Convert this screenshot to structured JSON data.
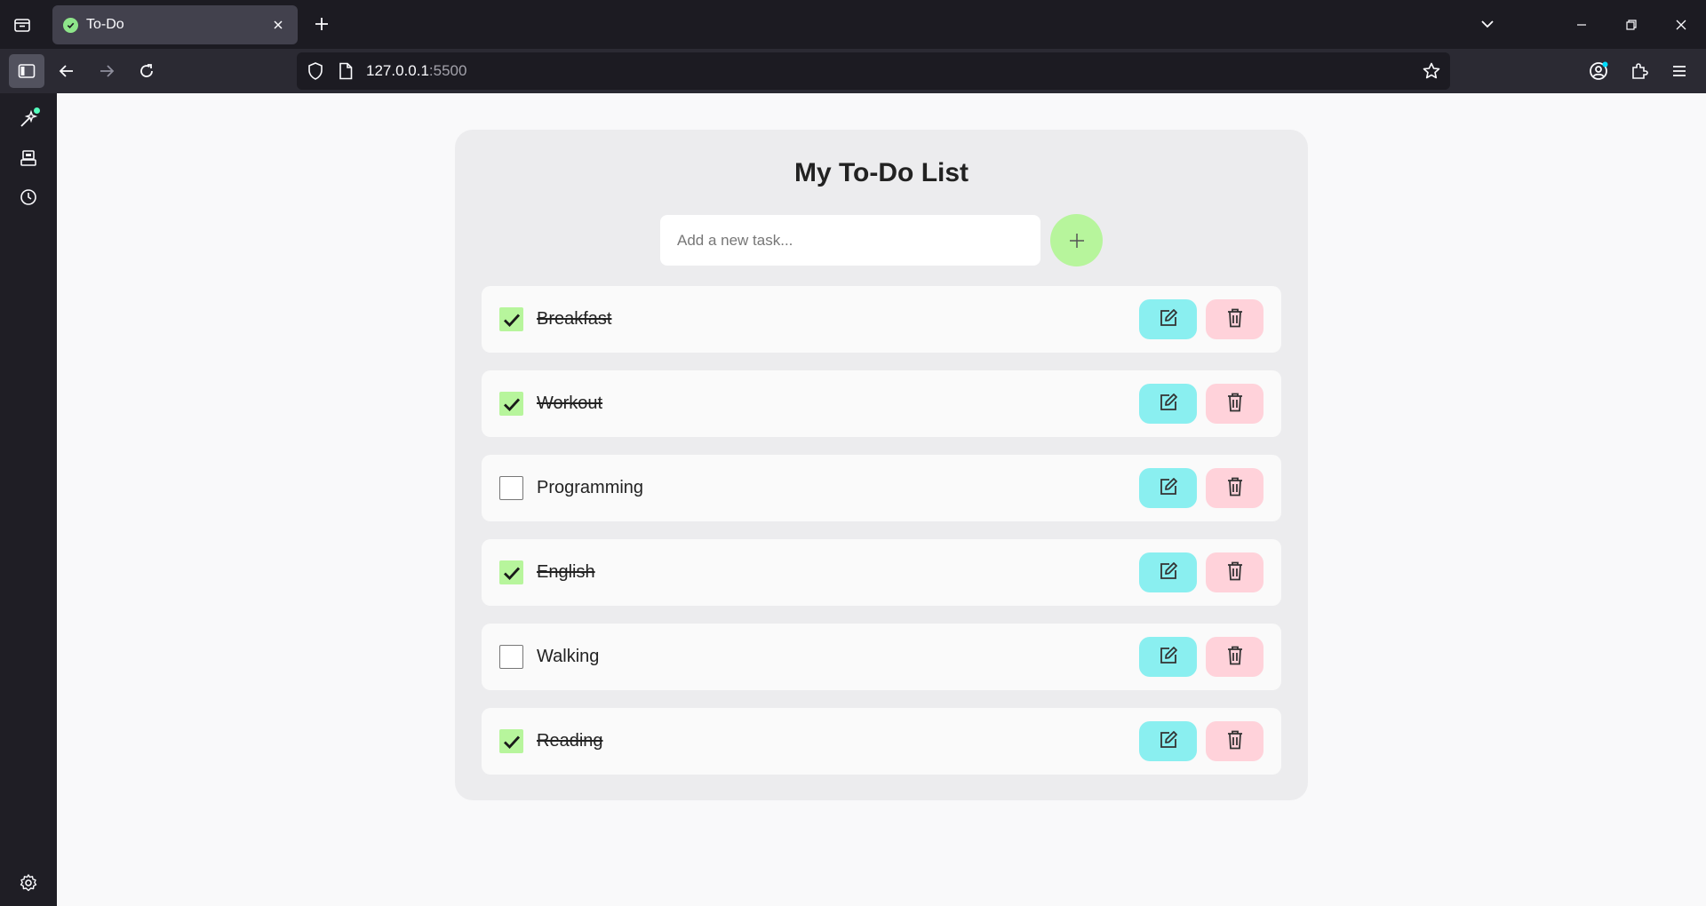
{
  "browser": {
    "tab": {
      "title": "To-Do"
    },
    "url": {
      "host": "127.0.0.1",
      "port": ":5500"
    }
  },
  "app": {
    "title": "My To-Do List",
    "input_placeholder": "Add a new task...",
    "input_value": "",
    "tasks": [
      {
        "label": "Breakfast",
        "done": true
      },
      {
        "label": "Workout",
        "done": true
      },
      {
        "label": "Programming",
        "done": false
      },
      {
        "label": "English",
        "done": true
      },
      {
        "label": "Walking",
        "done": false
      },
      {
        "label": "Reading",
        "done": true
      }
    ]
  },
  "colors": {
    "accent_green": "#b7f59c",
    "edit_button": "#8aeff0",
    "delete_button": "#ffd2da"
  },
  "icons": {
    "add": "plus-icon",
    "edit": "edit-icon",
    "delete": "trash-icon"
  }
}
